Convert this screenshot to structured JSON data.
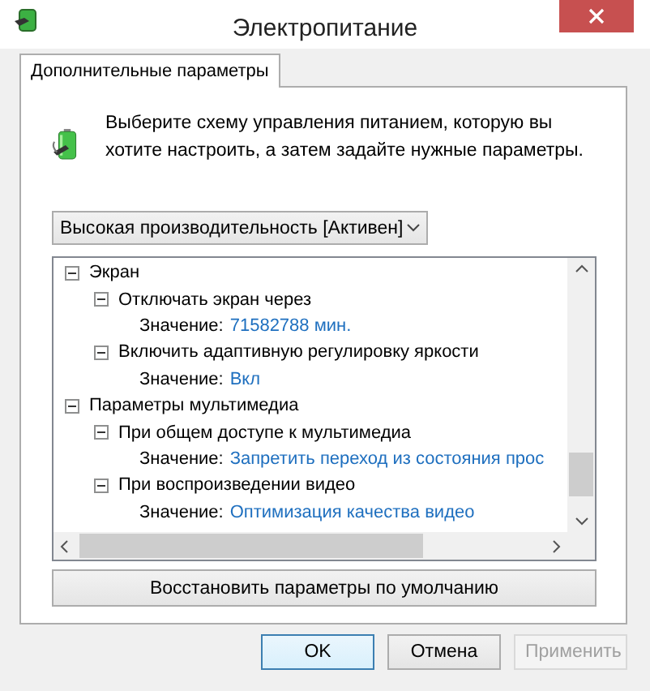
{
  "window": {
    "title": "Электропитание"
  },
  "tabs": [
    {
      "label": "Дополнительные параметры",
      "selected": true
    }
  ],
  "description": "Выберите схему управления питанием, которую вы хотите настроить, а затем задайте нужные параметры.",
  "plan_select": {
    "value": "Высокая производительность [Активен]"
  },
  "tree": [
    {
      "label": "Экран",
      "expanded": true,
      "children": [
        {
          "label": "Отключать экран через",
          "expanded": true,
          "value_label": "Значение:",
          "value": "71582788 мин."
        },
        {
          "label": "Включить адаптивную регулировку яркости",
          "expanded": true,
          "value_label": "Значение:",
          "value": "Вкл"
        }
      ]
    },
    {
      "label": "Параметры мультимедиа",
      "expanded": true,
      "children": [
        {
          "label": "При общем доступе к мультимедиа",
          "expanded": true,
          "value_label": "Значение:",
          "value": "Запретить переход из состояния прос"
        },
        {
          "label": "При воспроизведении видео",
          "expanded": true,
          "value_label": "Значение:",
          "value": "Оптимизация качества видео"
        }
      ]
    }
  ],
  "restore_button": {
    "label": "Восстановить параметры по умолчанию"
  },
  "buttons": [
    {
      "label": "OK",
      "default": true,
      "disabled": false
    },
    {
      "label": "Отмена",
      "default": false,
      "disabled": false
    },
    {
      "label": "Применить",
      "default": false,
      "disabled": true
    }
  ]
}
